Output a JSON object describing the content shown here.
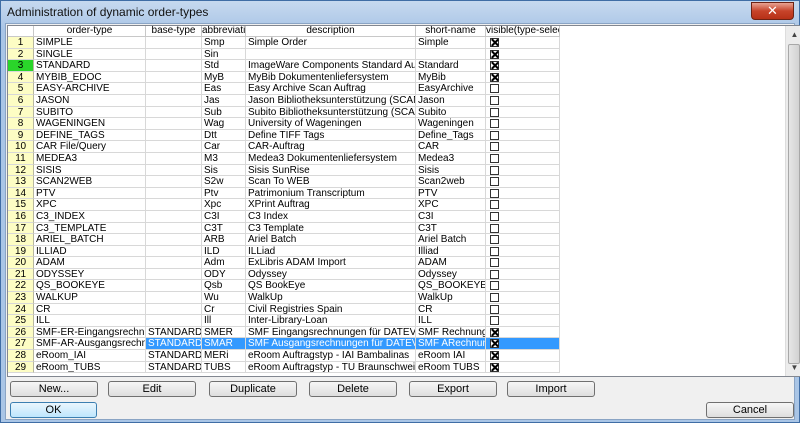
{
  "window": {
    "title": "Administration of dynamic order-types",
    "close_glyph": "✕"
  },
  "columns": [
    "",
    "order-type",
    "base-type",
    "abbreviation",
    "description",
    "short-name",
    "visible(type-selector)"
  ],
  "rows": [
    {
      "n": "1",
      "order_type": "SIMPLE",
      "base_type": "",
      "abbr": "Smp",
      "desc": "Simple Order",
      "short": "Simple",
      "visible": true
    },
    {
      "n": "2",
      "order_type": "SINGLE",
      "base_type": "",
      "abbr": "Sin",
      "desc": "",
      "short": "",
      "visible": true
    },
    {
      "n": "3",
      "order_type": "STANDARD",
      "base_type": "",
      "abbr": "Std",
      "desc": "ImageWare Components Standard Auftrag",
      "short": "Standard",
      "visible": true
    },
    {
      "n": "4",
      "order_type": "MYBIB_EDOC",
      "base_type": "",
      "abbr": "MyB",
      "desc": "MyBib Dokumentenliefersystem",
      "short": "MyBib",
      "visible": true
    },
    {
      "n": "5",
      "order_type": "EASY-ARCHIVE",
      "base_type": "",
      "abbr": "Eas",
      "desc": "Easy Archive Scan Auftrag",
      "short": "EasyArchive",
      "visible": false
    },
    {
      "n": "6",
      "order_type": "JASON",
      "base_type": "",
      "abbr": "Jas",
      "desc": "Jason Bibliotheksunterstützung (SCAN-Service)",
      "short": "Jason",
      "visible": false
    },
    {
      "n": "7",
      "order_type": "SUBITO",
      "base_type": "",
      "abbr": "Sub",
      "desc": "Subito Bibliotheksunterstützung (SCAN-Service)",
      "short": "Subito",
      "visible": false
    },
    {
      "n": "8",
      "order_type": "WAGENINGEN",
      "base_type": "",
      "abbr": "Wag",
      "desc": "University of Wageningen",
      "short": "Wageningen",
      "visible": false
    },
    {
      "n": "9",
      "order_type": "DEFINE_TAGS",
      "base_type": "",
      "abbr": "Dtt",
      "desc": "Define TIFF Tags",
      "short": "Define_Tags",
      "visible": false
    },
    {
      "n": "10",
      "order_type": "CAR File/Query",
      "base_type": "",
      "abbr": "Car",
      "desc": "CAR-Auftrag",
      "short": "CAR",
      "visible": false
    },
    {
      "n": "11",
      "order_type": "MEDEA3",
      "base_type": "",
      "abbr": "M3",
      "desc": "Medea3 Dokumentenliefersystem",
      "short": "Medea3",
      "visible": false
    },
    {
      "n": "12",
      "order_type": "SISIS",
      "base_type": "",
      "abbr": "Sis",
      "desc": "Sisis SunRise",
      "short": "Sisis",
      "visible": false
    },
    {
      "n": "13",
      "order_type": "SCAN2WEB",
      "base_type": "",
      "abbr": "S2w",
      "desc": "Scan To WEB",
      "short": "Scan2web",
      "visible": false
    },
    {
      "n": "14",
      "order_type": "PTV",
      "base_type": "",
      "abbr": "Ptv",
      "desc": "Patrimonium Transcriptum",
      "short": "PTV",
      "visible": false
    },
    {
      "n": "15",
      "order_type": "XPC",
      "base_type": "",
      "abbr": "Xpc",
      "desc": "XPrint Auftrag",
      "short": "XPC",
      "visible": false
    },
    {
      "n": "16",
      "order_type": "C3_INDEX",
      "base_type": "",
      "abbr": "C3I",
      "desc": "C3 Index",
      "short": "C3I",
      "visible": false
    },
    {
      "n": "17",
      "order_type": "C3_TEMPLATE",
      "base_type": "",
      "abbr": "C3T",
      "desc": "C3 Template",
      "short": "C3T",
      "visible": false
    },
    {
      "n": "18",
      "order_type": "ARIEL_BATCH",
      "base_type": "",
      "abbr": "ARB",
      "desc": "Ariel Batch",
      "short": "Ariel Batch",
      "visible": false
    },
    {
      "n": "19",
      "order_type": "ILLIAD",
      "base_type": "",
      "abbr": "ILD",
      "desc": "ILLiad",
      "short": "Illiad",
      "visible": false
    },
    {
      "n": "20",
      "order_type": "ADAM",
      "base_type": "",
      "abbr": "Adm",
      "desc": "ExLibris ADAM Import",
      "short": "ADAM",
      "visible": false
    },
    {
      "n": "21",
      "order_type": "ODYSSEY",
      "base_type": "",
      "abbr": "ODY",
      "desc": "Odyssey",
      "short": "Odyssey",
      "visible": false
    },
    {
      "n": "22",
      "order_type": "QS_BOOKEYE",
      "base_type": "",
      "abbr": "Qsb",
      "desc": "QS BookEye",
      "short": "QS_BOOKEYE",
      "visible": false
    },
    {
      "n": "23",
      "order_type": "WALKUP",
      "base_type": "",
      "abbr": "Wu",
      "desc": "WalkUp",
      "short": "WalkUp",
      "visible": false
    },
    {
      "n": "24",
      "order_type": "CR",
      "base_type": "",
      "abbr": "Cr",
      "desc": "Civil Registries Spain",
      "short": "CR",
      "visible": false
    },
    {
      "n": "25",
      "order_type": "ILL",
      "base_type": "",
      "abbr": "Ill",
      "desc": "Inter-Library-Loan",
      "short": "ILL",
      "visible": false
    },
    {
      "n": "26",
      "order_type": "SMF-ER-Eingangsrechnungen",
      "base_type": "STANDARD",
      "abbr": "SMER",
      "desc": "SMF Eingangsrechnungen für DATEV",
      "short": "SMF Rechnungen",
      "visible": true
    },
    {
      "n": "27",
      "order_type": "SMF-AR-Ausgangsrechnungen",
      "base_type": "STANDARD",
      "abbr": "SMAR",
      "desc": "SMF Ausgangsrechnungen für DATEV",
      "short": "SMF ARechnungen",
      "visible": true
    },
    {
      "n": "28",
      "order_type": "eRoom_IAI",
      "base_type": "STANDARD",
      "abbr": "MERi",
      "desc": "eRoom Auftragstyp - IAI Bambalinas",
      "short": "eRoom IAI",
      "visible": true
    },
    {
      "n": "29",
      "order_type": "eRoom_TUBS",
      "base_type": "STANDARD",
      "abbr": "TUBS",
      "desc": "eRoom Auftragstyp - TU Braunschweig",
      "short": "eRoom TUBS",
      "visible": true
    }
  ],
  "current_row": "3",
  "selected_row": "27",
  "scroll": {
    "up_glyph": "▲",
    "down_glyph": "▼"
  },
  "buttons": {
    "new": "New...",
    "edit": "Edit",
    "duplicate": "Duplicate",
    "delete": "Delete",
    "export": "Export",
    "import": "Import",
    "ok": "OK",
    "cancel": "Cancel"
  }
}
